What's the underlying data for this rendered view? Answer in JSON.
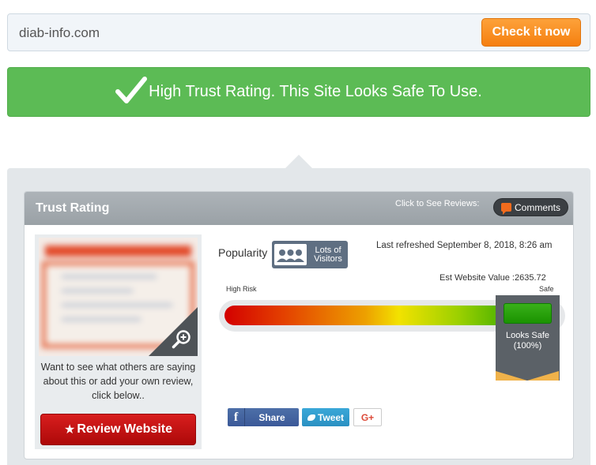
{
  "search": {
    "value": "diab-info.com",
    "button_label": "Check it now"
  },
  "banner": {
    "message": "High Trust Rating. This Site Looks Safe To Use.",
    "icon": "checkmark-icon",
    "color": "#5cbb55"
  },
  "card": {
    "title": "Trust Rating",
    "reviews_hint": "Click to See Reviews:",
    "comments_label": "Comments"
  },
  "left": {
    "prompt": "Want to see what others are saying about this or add your own review, click below..",
    "review_button_star": "★",
    "review_button_label": "Review Website"
  },
  "stats": {
    "popularity_label": "Popularity",
    "visitors_line1": "Lots of",
    "visitors_line2": "Visitors",
    "last_refreshed": "Last refreshed September 8, 2018, 8:26 am",
    "est_value": "Est Website Value :2635.72"
  },
  "meter": {
    "low_label": "High Risk",
    "high_label": "Safe",
    "status_label": "Looks Safe",
    "status_percent": "(100%)",
    "percent_value": 100
  },
  "social": {
    "facebook_label": "Share",
    "twitter_label": "Tweet",
    "gplus_label": "G+"
  }
}
